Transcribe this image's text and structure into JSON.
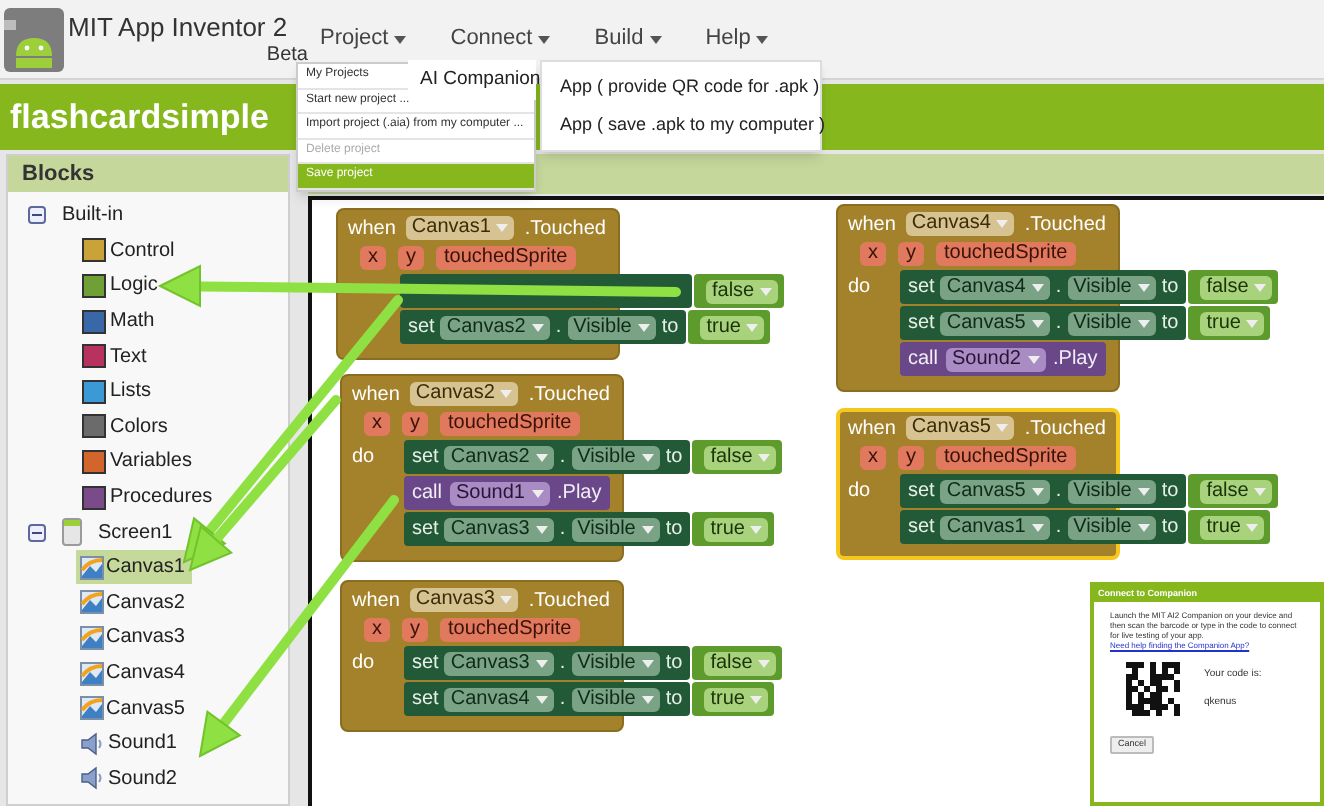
{
  "header": {
    "title": "MIT App Inventor 2",
    "badge": "Beta",
    "menus": [
      {
        "label": "Project"
      },
      {
        "label": "Connect"
      },
      {
        "label": "Build"
      },
      {
        "label": "Help"
      }
    ]
  },
  "project_menu": [
    {
      "label": "My Projects",
      "disabled": false,
      "selected": false
    },
    {
      "label": "Start new project ...",
      "disabled": false,
      "selected": false
    },
    {
      "label": "Import project (.aia) from my computer ...",
      "disabled": false,
      "selected": false
    },
    {
      "label": "Delete project",
      "disabled": true,
      "selected": false
    },
    {
      "label": "Save project",
      "disabled": false,
      "selected": true
    }
  ],
  "connect_menu": [
    "AI Companion"
  ],
  "build_menu": [
    "App ( provide QR code for .apk )",
    "App ( save .apk to my computer )"
  ],
  "project_name": "flashcardsimple",
  "blocks_panel": {
    "title": "Blocks",
    "tree": [
      {
        "label": "Built-in",
        "kind": "group",
        "expanded": true,
        "children": [
          {
            "label": "Control",
            "color": "#c9a33a"
          },
          {
            "label": "Logic",
            "color": "#6fa036"
          },
          {
            "label": "Math",
            "color": "#3868a8"
          },
          {
            "label": "Text",
            "color": "#b7325e"
          },
          {
            "label": "Lists",
            "color": "#3b9ad6"
          },
          {
            "label": "Colors",
            "color": "#6b6b6b"
          },
          {
            "label": "Variables",
            "color": "#d2652b"
          },
          {
            "label": "Procedures",
            "color": "#7a4a8a"
          }
        ]
      },
      {
        "label": "Screen1",
        "kind": "screen",
        "expanded": true,
        "children": [
          {
            "label": "Canvas1",
            "kind": "canvas",
            "selected": true
          },
          {
            "label": "Canvas2",
            "kind": "canvas",
            "selected": false
          },
          {
            "label": "Canvas3",
            "kind": "canvas",
            "selected": false
          },
          {
            "label": "Canvas4",
            "kind": "canvas",
            "selected": false
          },
          {
            "label": "Canvas5",
            "kind": "canvas",
            "selected": false
          },
          {
            "label": "Sound1",
            "kind": "sound",
            "selected": false
          },
          {
            "label": "Sound2",
            "kind": "sound",
            "selected": false
          }
        ]
      }
    ]
  },
  "workspace": {
    "blocks": [
      {
        "when": "when",
        "component": "Canvas1",
        "event": ".Touched",
        "params": [
          "x",
          "y",
          "touchedSprite"
        ],
        "selected": false,
        "statements": [
          {
            "kind": "set",
            "value": "false"
          },
          {
            "kind": "set",
            "keyword": "set",
            "component": "Canvas2",
            "dot": ".",
            "property": "Visible",
            "to": "to",
            "value": "true"
          }
        ]
      },
      {
        "when": "when",
        "component": "Canvas2",
        "event": ".Touched",
        "params": [
          "x",
          "y",
          "touchedSprite"
        ],
        "do": "do",
        "selected": false,
        "statements": [
          {
            "kind": "set",
            "keyword": "set",
            "component": "Canvas2",
            "dot": ".",
            "property": "Visible",
            "to": "to",
            "value": "false"
          },
          {
            "kind": "call",
            "keyword": "call",
            "component": "Sound1",
            "method": ".Play"
          },
          {
            "kind": "set",
            "keyword": "set",
            "component": "Canvas3",
            "dot": ".",
            "property": "Visible",
            "to": "to",
            "value": "true"
          }
        ]
      },
      {
        "when": "when",
        "component": "Canvas3",
        "event": ".Touched",
        "params": [
          "x",
          "y",
          "touchedSprite"
        ],
        "do": "do",
        "selected": false,
        "statements": [
          {
            "kind": "set",
            "keyword": "set",
            "component": "Canvas3",
            "dot": ".",
            "property": "Visible",
            "to": "to",
            "value": "false"
          },
          {
            "kind": "set",
            "keyword": "set",
            "component": "Canvas4",
            "dot": ".",
            "property": "Visible",
            "to": "to",
            "value": "true"
          }
        ]
      },
      {
        "when": "when",
        "component": "Canvas4",
        "event": ".Touched",
        "params": [
          "x",
          "y",
          "touchedSprite"
        ],
        "do": "do",
        "selected": false,
        "statements": [
          {
            "kind": "set",
            "keyword": "set",
            "component": "Canvas4",
            "dot": ".",
            "property": "Visible",
            "to": "to",
            "value": "false"
          },
          {
            "kind": "set",
            "keyword": "set",
            "component": "Canvas5",
            "dot": ".",
            "property": "Visible",
            "to": "to",
            "value": "true"
          },
          {
            "kind": "call",
            "keyword": "call",
            "component": "Sound2",
            "method": ".Play"
          }
        ]
      },
      {
        "when": "when",
        "component": "Canvas5",
        "event": ".Touched",
        "params": [
          "x",
          "y",
          "touchedSprite"
        ],
        "do": "do",
        "selected": true,
        "statements": [
          {
            "kind": "set",
            "keyword": "set",
            "component": "Canvas5",
            "dot": ".",
            "property": "Visible",
            "to": "to",
            "value": "false"
          },
          {
            "kind": "set",
            "keyword": "set",
            "component": "Canvas1",
            "dot": ".",
            "property": "Visible",
            "to": "to",
            "value": "true"
          }
        ]
      }
    ]
  },
  "companion_dialog": {
    "title": "Connect to Companion",
    "text": "Launch the MIT AI2 Companion on your device and then scan the barcode or type in the code to connect for live testing of your app.",
    "link": "Need help finding the Companion App?",
    "code_label": "Your code is:",
    "code": "qkenus",
    "button": "Cancel"
  }
}
